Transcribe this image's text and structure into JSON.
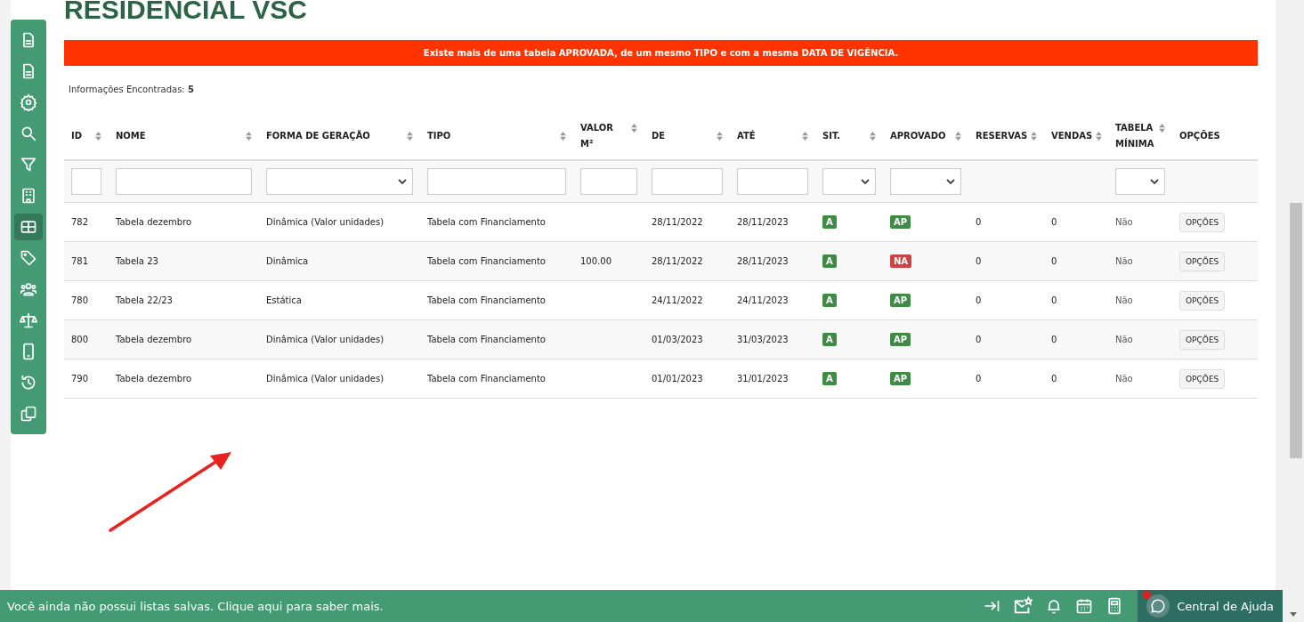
{
  "page_title": "RESIDENCIAL VSC",
  "sidebar": {
    "items": [
      {
        "selected": false
      },
      {
        "selected": false
      },
      {
        "selected": false
      },
      {
        "selected": false
      },
      {
        "selected": false
      },
      {
        "selected": false
      },
      {
        "selected": true
      },
      {
        "selected": false
      },
      {
        "selected": false
      },
      {
        "selected": false
      },
      {
        "selected": false
      },
      {
        "selected": false
      },
      {
        "selected": false
      }
    ]
  },
  "alert": "Existe mais de uma tabela APROVADA, de um mesmo TIPO e com a mesma DATA DE VIGÊNCIA.",
  "result_count": "Informações Encontradas: **5**",
  "table": {
    "columns": [
      {
        "label": "ID",
        "sortable": true,
        "kind": "text"
      },
      {
        "label": "NOME",
        "sortable": true,
        "kind": "text"
      },
      {
        "label": "FORMA DE GERAÇÃO",
        "sortable": true,
        "kind": "select"
      },
      {
        "label": "TIPO",
        "sortable": true,
        "kind": "text"
      },
      {
        "label": "VALOR M²",
        "sortable": true,
        "kind": "text"
      },
      {
        "label": "DE",
        "sortable": true,
        "kind": "text"
      },
      {
        "label": "ATÉ",
        "sortable": true,
        "kind": "text"
      },
      {
        "label": "SIT.",
        "sortable": true,
        "kind": "select"
      },
      {
        "label": "APROVADO",
        "sortable": true,
        "kind": "select"
      },
      {
        "label": "RESERVAS",
        "sortable": true,
        "kind": "plain"
      },
      {
        "label": "VENDAS",
        "sortable": true,
        "kind": "plain"
      },
      {
        "label": "TABELA MÍNIMA",
        "sortable": true,
        "kind": "select"
      },
      {
        "label": "OPÇÕES",
        "sortable": false,
        "kind": "plain"
      }
    ],
    "rows": [
      {
        "id": "782",
        "nome": "Tabela dezembro",
        "forma": "Dinâmica (Valor unidades)",
        "tipo": "Tabela com Financiamento",
        "valor": "",
        "de": "28/11/2022",
        "ate": "28/11/2023",
        "sit": {
          "text": "A",
          "color": "#3f8a45"
        },
        "aprovado": {
          "text": "AP",
          "color": "#3f8a45"
        },
        "reservas": "0",
        "vendas": "0",
        "minima": "Não",
        "opcoes": "OPÇÕES"
      },
      {
        "id": "781",
        "nome": "Tabela 23",
        "forma": "Dinâmica",
        "tipo": "Tabela com Financiamento",
        "valor": "100.00",
        "de": "28/11/2022",
        "ate": "28/11/2023",
        "sit": {
          "text": "A",
          "color": "#3f8a45"
        },
        "aprovado": {
          "text": "NA",
          "color": "#c94442"
        },
        "reservas": "0",
        "vendas": "0",
        "minima": "Não",
        "opcoes": "OPÇÕES"
      },
      {
        "id": "780",
        "nome": "Tabela 22/23",
        "forma": "Estática",
        "tipo": "Tabela com Financiamento",
        "valor": "",
        "de": "24/11/2022",
        "ate": "24/11/2023",
        "sit": {
          "text": "A",
          "color": "#3f8a45"
        },
        "aprovado": {
          "text": "AP",
          "color": "#3f8a45"
        },
        "reservas": "0",
        "vendas": "0",
        "minima": "Não",
        "opcoes": "OPÇÕES"
      },
      {
        "id": "800",
        "nome": "Tabela dezembro",
        "forma": "Dinâmica (Valor unidades)",
        "tipo": "Tabela com Financiamento",
        "valor": "",
        "de": "01/03/2023",
        "ate": "31/03/2023",
        "sit": {
          "text": "A",
          "color": "#3f8a45"
        },
        "aprovado": {
          "text": "AP",
          "color": "#3f8a45"
        },
        "reservas": "0",
        "vendas": "0",
        "minima": "Não",
        "opcoes": "OPÇÕES"
      },
      {
        "id": "790",
        "nome": "Tabela dezembro",
        "forma": "Dinâmica (Valor unidades)",
        "tipo": "Tabela com Financiamento",
        "valor": "",
        "de": "01/01/2023",
        "ate": "31/01/2023",
        "sit": {
          "text": "A",
          "color": "#3f8a45"
        },
        "aprovado": {
          "text": "AP",
          "color": "#3f8a45"
        },
        "reservas": "0",
        "vendas": "0",
        "minima": "Não",
        "opcoes": "OPÇÕES"
      }
    ]
  },
  "bottom_bar": {
    "message": "Você ainda não possui listas salvas. Clique aqui para saber mais.",
    "help": "Central de Ajuda",
    "help_notification": true
  }
}
